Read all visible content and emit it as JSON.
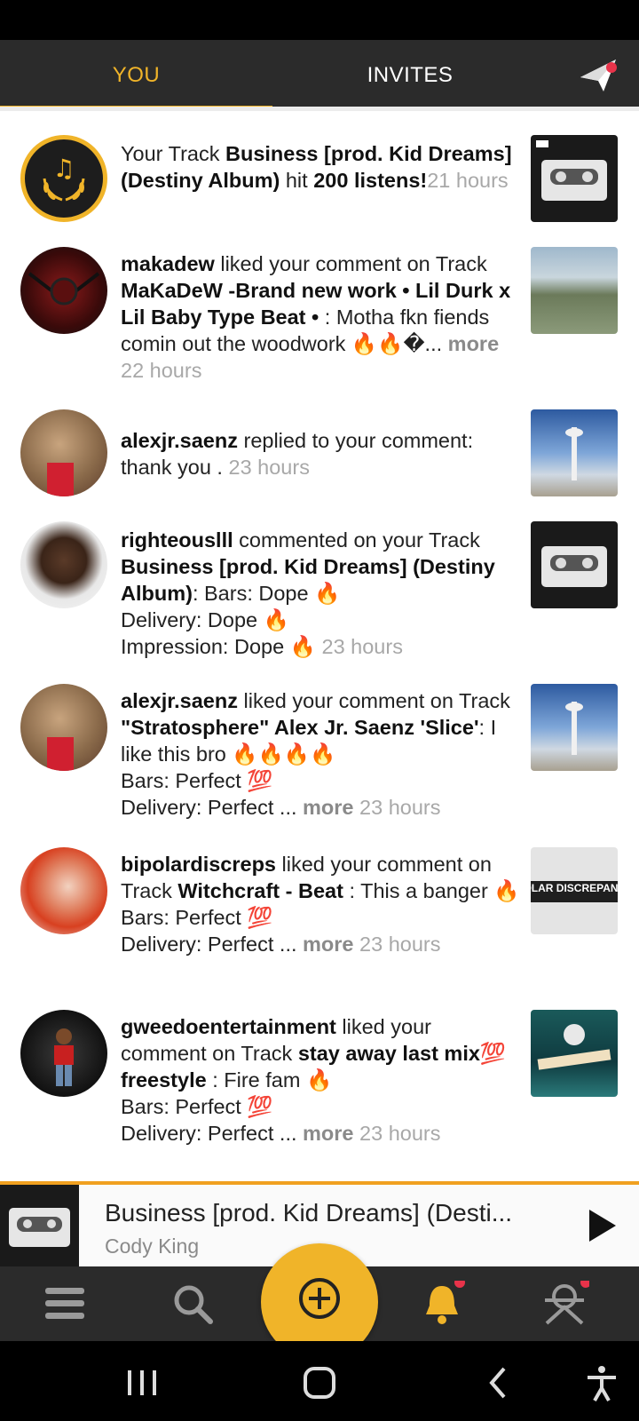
{
  "tabs": {
    "you": "YOU",
    "invites": "INVITES"
  },
  "colors": {
    "accent": "#f0b429",
    "dark_bar": "#2b2b2b",
    "badge": "#e8334a"
  },
  "feed": [
    {
      "avatar_icon": "music-laurel-icon",
      "parts": [
        {
          "t": "Your Track ",
          "s": "n"
        },
        {
          "t": "Business [prod. Kid Dreams] (Destiny Album)",
          "s": "b"
        },
        {
          "t": " hit ",
          "s": "n"
        },
        {
          "t": "200 listens!",
          "s": "b"
        }
      ],
      "time": "21 hours",
      "thumb": "cassette-cover"
    },
    {
      "avatar_icon": "makadew-avatar",
      "parts": [
        {
          "t": "makadew",
          "s": "b"
        },
        {
          "t": " liked your comment on Track ",
          "s": "n"
        },
        {
          "t": "MaKaDeW -Brand new work • Lil Durk x Lil Baby Type Beat • ",
          "s": "b"
        },
        {
          "t": " : Motha fkn fiends comin out the woodwork 🔥🔥�... ",
          "s": "n"
        }
      ],
      "more": "more",
      "time": "22 hours",
      "thumb": "lake-cover"
    },
    {
      "avatar_icon": "user-avatar",
      "parts": [
        {
          "t": "alexjr.saenz",
          "s": "b"
        },
        {
          "t": " replied to your comment: thank you . ",
          "s": "n"
        }
      ],
      "time": "23 hours",
      "thumb": "tower-cover"
    },
    {
      "avatar_icon": "user-avatar",
      "parts": [
        {
          "t": "righteouslll",
          "s": "b"
        },
        {
          "t": " commented on your Track ",
          "s": "n"
        },
        {
          "t": "Business [prod. Kid Dreams] (Destiny Album)",
          "s": "b"
        },
        {
          "t": ": Bars: Dope 🔥\nDelivery: Dope 🔥\nImpression: Dope 🔥 ",
          "s": "n"
        }
      ],
      "time": "23 hours",
      "thumb": "cassette-cover"
    },
    {
      "avatar_icon": "user-avatar",
      "parts": [
        {
          "t": "alexjr.saenz",
          "s": "b"
        },
        {
          "t": " liked your comment on Track ",
          "s": "n"
        },
        {
          "t": "\"Stratosphere\" Alex Jr. Saenz 'Slice'",
          "s": "b"
        },
        {
          "t": ": I like this bro 🔥🔥🔥🔥\nBars: Perfect 💯\nDelivery: Perfect ... ",
          "s": "n"
        }
      ],
      "more": "more",
      "time": "23 hours",
      "thumb": "tower-cover"
    },
    {
      "avatar_icon": "user-avatar",
      "parts": [
        {
          "t": "bipolardiscreps",
          "s": "b"
        },
        {
          "t": " liked your comment on Track ",
          "s": "n"
        },
        {
          "t": "Witchcraft - Beat",
          "s": "b"
        },
        {
          "t": " : This a banger 🔥\nBars: Perfect 💯\nDelivery: Perfect ... ",
          "s": "n"
        }
      ],
      "more": "more",
      "time": "23 hours",
      "thumb": "bipolar-cover",
      "thumb_text": "BIPOLAR DISCREPANCIES"
    },
    {
      "avatar_icon": "user-avatar",
      "parts": [
        {
          "t": "gweedoentertainment",
          "s": "b"
        },
        {
          "t": " liked your comment on Track ",
          "s": "n"
        },
        {
          "t": "stay away last mix💯 freestyle",
          "s": "b"
        },
        {
          "t": " : Fire fam 🔥\nBars: Perfect 💯\nDelivery: Perfect ... ",
          "s": "n"
        }
      ],
      "more": "more",
      "time": "23 hours",
      "thumb": "teal-cover"
    }
  ],
  "player": {
    "title": "Business [prod. Kid Dreams] (Desti...",
    "artist": "Cody King"
  },
  "nav": [
    "feed-icon",
    "search-icon",
    "add-icon",
    "bell-icon",
    "profile-icon"
  ]
}
